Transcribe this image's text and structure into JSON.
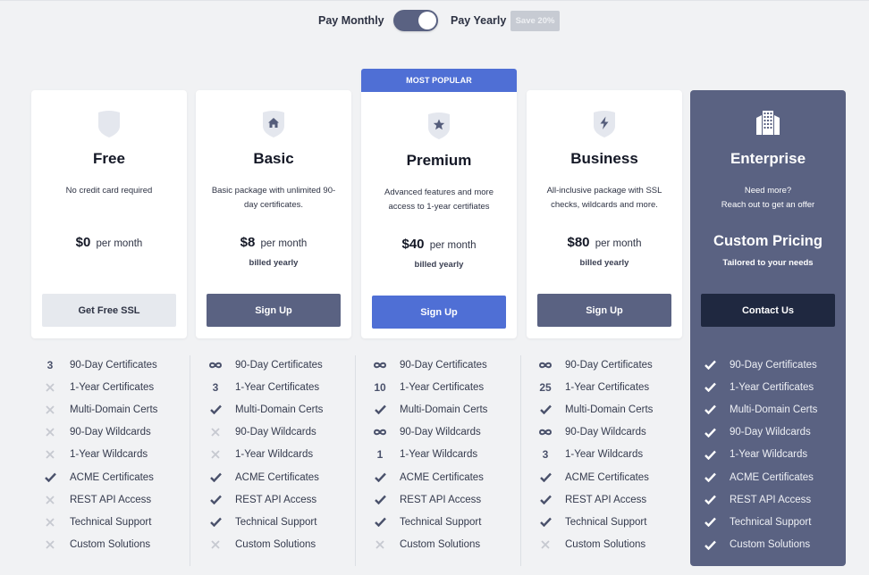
{
  "billing": {
    "monthly_label": "Pay Monthly",
    "yearly_label": "Pay Yearly",
    "selected": "yearly",
    "save_badge": "Save 20%"
  },
  "plans": [
    {
      "name": "Free",
      "icon": "shield-icon",
      "description": "No credit card required",
      "price": "$0",
      "per": "per month",
      "billed": "",
      "cta": "Get Free SSL"
    },
    {
      "name": "Basic",
      "icon": "home-shield-icon",
      "description": "Basic package with unlimited 90-day certificates.",
      "price": "$8",
      "per": "per month",
      "billed": "billed yearly",
      "cta": "Sign Up"
    },
    {
      "name": "Premium",
      "icon": "star-shield-icon",
      "ribbon": "MOST POPULAR",
      "description": "Advanced features and more access to 1-year certifiates",
      "price": "$40",
      "per": "per month",
      "billed": "billed yearly",
      "cta": "Sign Up"
    },
    {
      "name": "Business",
      "icon": "bolt-shield-icon",
      "description": "All-inclusive package with SSL checks, wildcards and more.",
      "price": "$80",
      "per": "per month",
      "billed": "billed yearly",
      "cta": "Sign Up"
    },
    {
      "name": "Enterprise",
      "icon": "building-icon",
      "description_line1": "Need more?",
      "description_line2": "Reach out to get an offer",
      "price": "Custom Pricing",
      "subtitle": "Tailored to your needs",
      "cta": "Contact Us"
    }
  ],
  "feature_names": [
    "90-Day Certificates",
    "1-Year Certificates",
    "Multi-Domain Certs",
    "90-Day Wildcards",
    "1-Year Wildcards",
    "ACME Certificates",
    "REST API Access",
    "Technical Support",
    "Custom Solutions"
  ],
  "feature_values": {
    "Free": [
      "3",
      "no",
      "no",
      "no",
      "no",
      "yes",
      "no",
      "no",
      "no"
    ],
    "Basic": [
      "inf",
      "3",
      "yes",
      "no",
      "no",
      "yes",
      "yes",
      "yes",
      "no"
    ],
    "Premium": [
      "inf",
      "10",
      "yes",
      "inf",
      "1",
      "yes",
      "yes",
      "yes",
      "no"
    ],
    "Business": [
      "inf",
      "25",
      "yes",
      "inf",
      "3",
      "yes",
      "yes",
      "yes",
      "no"
    ],
    "Enterprise": [
      "yes",
      "yes",
      "yes",
      "yes",
      "yes",
      "yes",
      "yes",
      "yes",
      "yes"
    ]
  },
  "colors": {
    "accent": "#4f6fd5",
    "slate": "#5a6282",
    "navy": "#1f2840",
    "background": "#f1f2f4"
  }
}
